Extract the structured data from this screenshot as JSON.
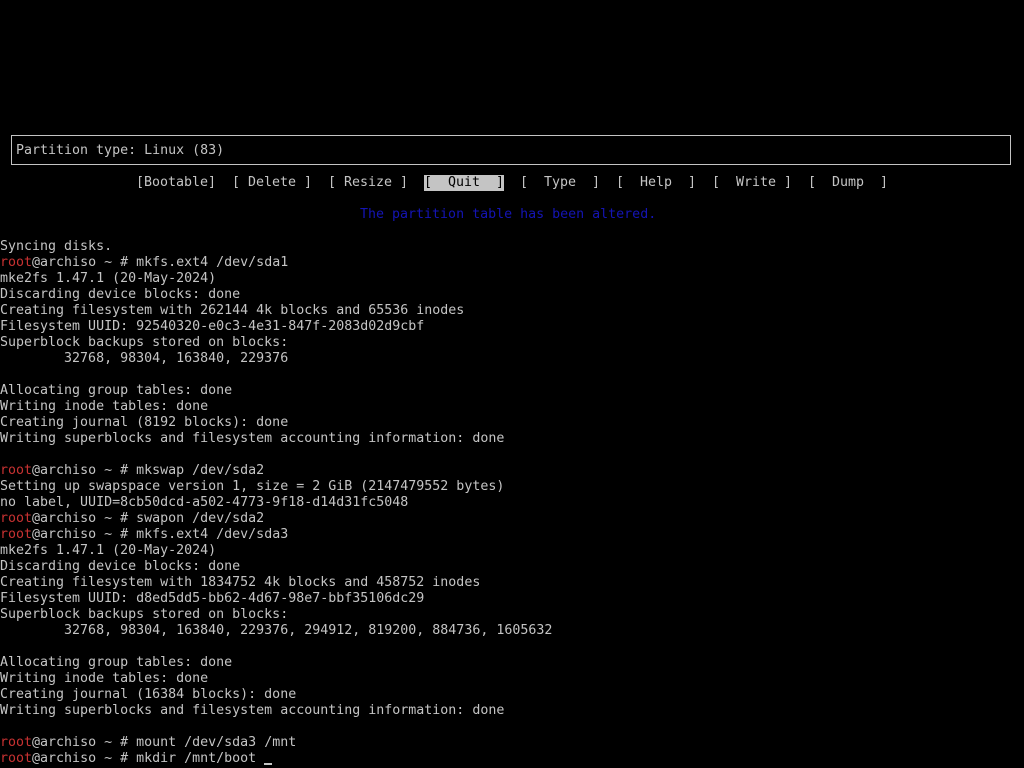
{
  "colors": {
    "background": "#000000",
    "foreground": "#c4c4c4",
    "prompt_user": "#c83232",
    "status_message": "#1414b4"
  },
  "cfdisk": {
    "partition_type_line": "Partition type: Linux (83)",
    "menu": [
      {
        "label": "[Bootable]",
        "selected": false
      },
      {
        "label": "[ Delete ]",
        "selected": false
      },
      {
        "label": "[ Resize ]",
        "selected": false
      },
      {
        "label": "[  Quit  ]",
        "selected": true
      },
      {
        "label": "[  Type  ]",
        "selected": false
      },
      {
        "label": "[  Help  ]",
        "selected": false
      },
      {
        "label": "[  Write ]",
        "selected": false
      },
      {
        "label": "[  Dump  ]",
        "selected": false
      }
    ],
    "status_message": "The partition table has been altered."
  },
  "terminal": {
    "lines": [
      {
        "text": "Syncing disks."
      },
      {
        "user": "root",
        "text": "@archiso ~ # mkfs.ext4 /dev/sda1"
      },
      {
        "text": "mke2fs 1.47.1 (20-May-2024)"
      },
      {
        "text": "Discarding device blocks: done"
      },
      {
        "text": "Creating filesystem with 262144 4k blocks and 65536 inodes"
      },
      {
        "text": "Filesystem UUID: 92540320-e0c3-4e31-847f-2083d02d9cbf"
      },
      {
        "text": "Superblock backups stored on blocks:"
      },
      {
        "text": "        32768, 98304, 163840, 229376"
      },
      {
        "text": ""
      },
      {
        "text": "Allocating group tables: done"
      },
      {
        "text": "Writing inode tables: done"
      },
      {
        "text": "Creating journal (8192 blocks): done"
      },
      {
        "text": "Writing superblocks and filesystem accounting information: done"
      },
      {
        "text": ""
      },
      {
        "user": "root",
        "text": "@archiso ~ # mkswap /dev/sda2"
      },
      {
        "text": "Setting up swapspace version 1, size = 2 GiB (2147479552 bytes)"
      },
      {
        "text": "no label, UUID=8cb50dcd-a502-4773-9f18-d14d31fc5048"
      },
      {
        "user": "root",
        "text": "@archiso ~ # swapon /dev/sda2"
      },
      {
        "user": "root",
        "text": "@archiso ~ # mkfs.ext4 /dev/sda3"
      },
      {
        "text": "mke2fs 1.47.1 (20-May-2024)"
      },
      {
        "text": "Discarding device blocks: done"
      },
      {
        "text": "Creating filesystem with 1834752 4k blocks and 458752 inodes"
      },
      {
        "text": "Filesystem UUID: d8ed5dd5-bb62-4d67-98e7-bbf35106dc29"
      },
      {
        "text": "Superblock backups stored on blocks:"
      },
      {
        "text": "        32768, 98304, 163840, 229376, 294912, 819200, 884736, 1605632"
      },
      {
        "text": ""
      },
      {
        "text": "Allocating group tables: done"
      },
      {
        "text": "Writing inode tables: done"
      },
      {
        "text": "Creating journal (16384 blocks): done"
      },
      {
        "text": "Writing superblocks and filesystem accounting information: done"
      },
      {
        "text": ""
      },
      {
        "user": "root",
        "text": "@archiso ~ # mount /dev/sda3 /mnt"
      },
      {
        "user": "root",
        "text": "@archiso ~ # mkdir /mnt/boot",
        "cursor": true
      }
    ]
  }
}
